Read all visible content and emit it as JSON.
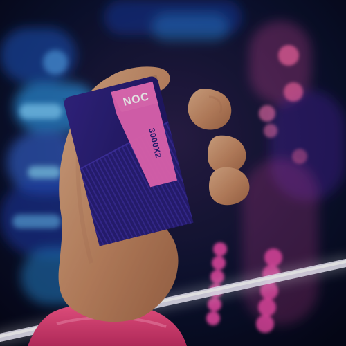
{
  "image": {
    "box": {
      "brand_text": "NOC",
      "side_text": "3000X2"
    },
    "colors": {
      "box_navy": "#2a1f7a",
      "box_stripe": "#3a2d9c",
      "box_pink": "#f06bbf",
      "sleeve_pink": "#e23b79",
      "neon_blue": "#2fa7ff",
      "neon_pink": "#ff4fb3",
      "neon_white": "#f3f0ff",
      "skin": "#d59f7a"
    }
  }
}
